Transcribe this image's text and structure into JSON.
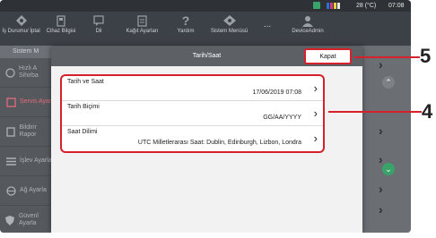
{
  "status": {
    "temperature": "28 (°C)",
    "time": "07:08"
  },
  "nav": [
    {
      "label": "İş Durumu/ İptal",
      "icon": "job-status-icon"
    },
    {
      "label": "Cihaz Bilgisi",
      "icon": "device-info-icon"
    },
    {
      "label": "Dil",
      "icon": "language-icon"
    },
    {
      "label": "Kağıt Ayarları",
      "icon": "paper-settings-icon"
    },
    {
      "label": "Yardım",
      "icon": "help-icon"
    },
    {
      "label": "Sistem Menüsü",
      "icon": "system-menu-icon"
    },
    {
      "label": "...",
      "icon": "more-icon"
    },
    {
      "label": "DeviceAdmin",
      "icon": "user-icon"
    }
  ],
  "sidebar": {
    "header": "Sistem M",
    "items": [
      {
        "label": "Hızlı A Sihirba",
        "icon": "wizard-icon"
      },
      {
        "label": "Servis Ayarı",
        "icon": "service-icon"
      },
      {
        "label": "Bildirir Rapor",
        "icon": "report-icon"
      },
      {
        "label": "İşlev Ayarla",
        "icon": "function-icon"
      },
      {
        "label": "Ağ Ayarla",
        "icon": "network-icon"
      },
      {
        "label": "Güvenl Ayarla",
        "icon": "security-icon"
      }
    ]
  },
  "modal": {
    "title": "Tarih/Saat",
    "close_label": "Kapat",
    "rows": [
      {
        "label": "Tarih ve Saat",
        "value": "17/06/2019 07:08"
      },
      {
        "label": "Tarih Biçimi",
        "value": "GG/AA/YYYY"
      },
      {
        "label": "Saat Dilimi",
        "value": "UTC Milletlerarası Saat: Dublin, Edinburgh, Lizbon, Londra"
      }
    ]
  },
  "callouts": {
    "close": "5",
    "list": "4"
  },
  "colors": {
    "highlight": "#d6202a",
    "accent_green": "#3aa36a"
  }
}
